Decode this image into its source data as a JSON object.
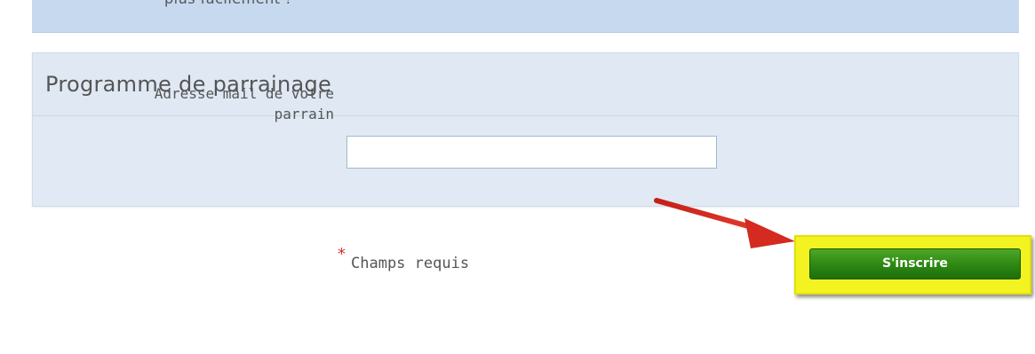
{
  "top_panel": {
    "text": "plus facilement !"
  },
  "referral_section": {
    "title": "Programme de parrainage",
    "sponsor_email": {
      "label_line1": "Adresse mail de votre",
      "label_line2": "parrain",
      "value": "",
      "placeholder": ""
    }
  },
  "form_footer": {
    "required_marker": "*",
    "required_text": "Champs requis",
    "submit_label": "S'inscrire"
  },
  "annotations": {
    "arrow_color": "#d42a20",
    "highlight_color": "#f4f322"
  },
  "colors": {
    "panel_bg": "#e0e9f4",
    "top_panel_bg": "#c6d9ef",
    "button_green": "#2f8a14",
    "required_red": "#d8312c"
  }
}
